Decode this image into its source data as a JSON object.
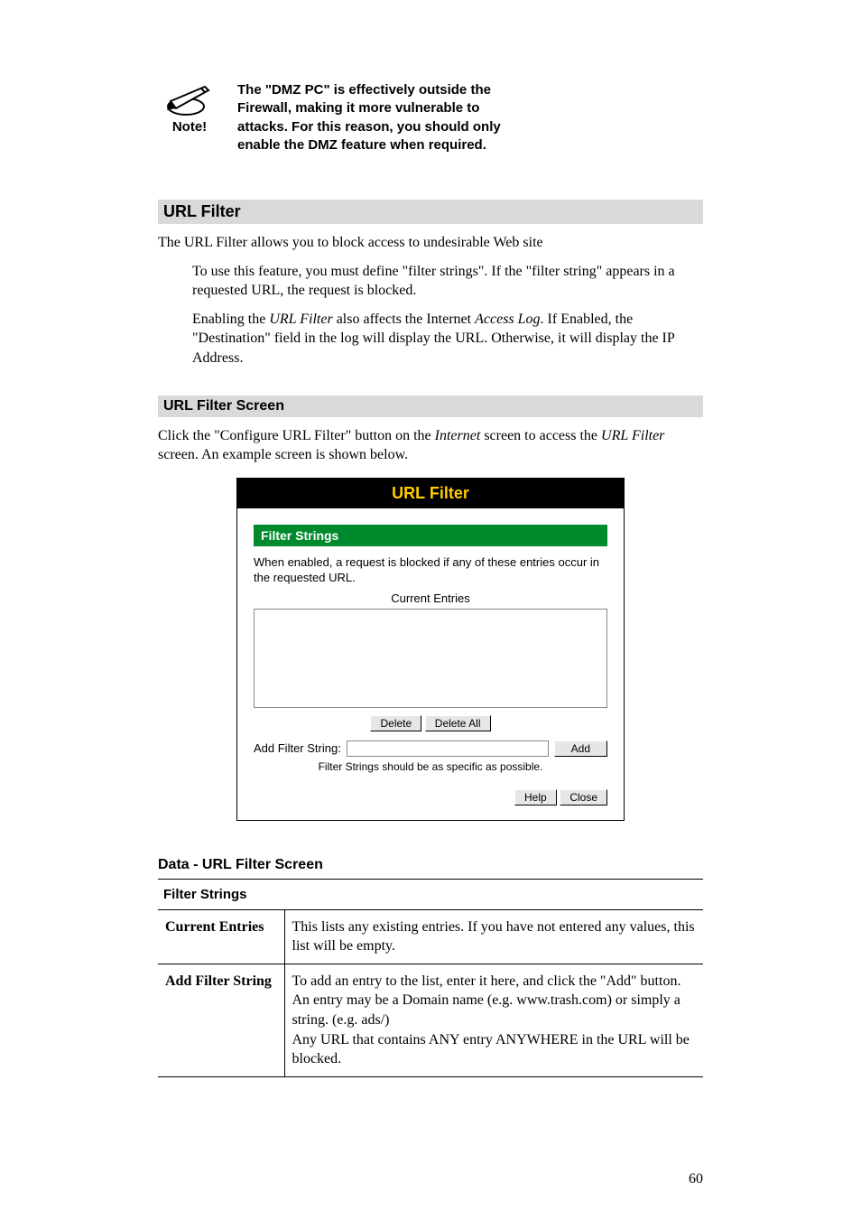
{
  "note": {
    "icon_label": "Note!",
    "text": "The \"DMZ PC\" is effectively outside the Firewall, making it more vulnerable to attacks. For this reason, you should only enable the DMZ feature when required."
  },
  "section1": {
    "heading": "URL Filter",
    "intro": "The URL Filter allows you to block access to undesirable Web site",
    "bullet1": "To use this feature, you must define \"filter strings\". If the \"filter string\" appears in a requested URL, the request is blocked.",
    "bullet2a": "Enabling the ",
    "bullet2b_ital": "URL Filter",
    "bullet2c": " also affects the Internet ",
    "bullet2d_ital": "Access Log",
    "bullet2e": ". If Enabled, the \"Destination\" field in the log will display the URL. Otherwise, it will display the IP Address."
  },
  "section2": {
    "heading": "URL Filter Screen",
    "desc_a": "Click the \"Configure URL Filter\" button on the ",
    "desc_b_ital": "Internet",
    "desc_c": " screen to access the ",
    "desc_d_ital": "URL Filter",
    "desc_e": " screen. An example screen is shown below."
  },
  "router": {
    "title": "URL Filter",
    "section_label": "Filter Strings",
    "desc": "When enabled, a request is blocked if any of these entries occur in the requested URL.",
    "current_label": "Current Entries",
    "delete_label": "Delete",
    "delete_all_label": "Delete All",
    "add_filter_label": "Add Filter String:",
    "add_btn_label": "Add",
    "hint": "Filter Strings should be as specific as possible.",
    "help_label": "Help",
    "close_label": "Close"
  },
  "data_section": {
    "heading": "Data - URL Filter Screen",
    "group": "Filter Strings",
    "row1_key": "Current Entries",
    "row1_val": "This lists any existing entries. If you have not entered any values, this list will be empty.",
    "row2_key": "Add Filter String",
    "row2_val": "To add an entry to the list, enter it here, and click the \"Add\" button. An entry may be a Domain name (e.g. www.trash.com) or simply a string. (e.g. ads/)\nAny URL that contains ANY entry ANYWHERE in the URL will be blocked."
  },
  "page_number": "60"
}
